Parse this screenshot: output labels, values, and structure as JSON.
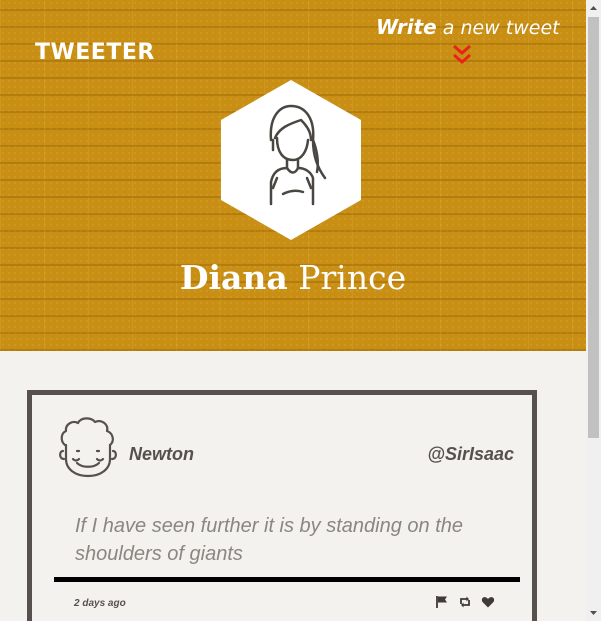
{
  "header": {
    "logo": "TWEETER",
    "write_bold": "Write",
    "write_rest": " a new tweet"
  },
  "profile": {
    "first_name": "Diana",
    "last_name": " Prince"
  },
  "tweet": {
    "author": "Newton",
    "handle": "@SirIsaac",
    "text": "If I have seen further it is by standing on the shoulders of giants",
    "time": "2 days ago",
    "actions": [
      "flag-icon",
      "retweet-icon",
      "heart-icon"
    ]
  },
  "colors": {
    "banner": "#c98e14",
    "chevron": "#e8241a",
    "card_border": "#56514c",
    "page_bg": "#f4f2ee"
  }
}
